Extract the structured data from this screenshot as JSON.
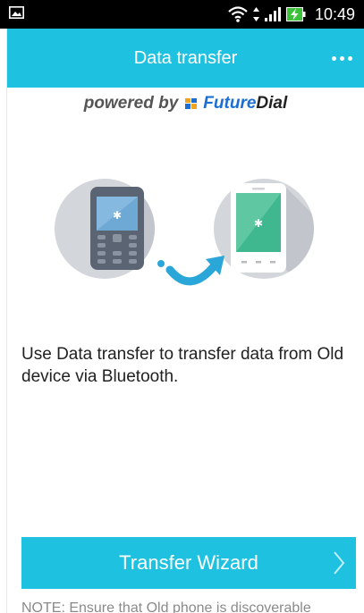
{
  "status_bar": {
    "time": "10:49",
    "icons": [
      "gallery-icon",
      "wifi-icon",
      "data-arrows-icon",
      "signal-icon",
      "battery-charging-icon"
    ]
  },
  "app_bar": {
    "title": "Data transfer",
    "overflow_icon": "more-dots-icon"
  },
  "branding": {
    "powered_by": "powered by",
    "brand_future": "Future",
    "brand_dial": "Dial"
  },
  "illustration": {
    "old_phone_icon": "feature-phone-bluetooth-icon",
    "new_phone_icon": "smartphone-bluetooth-icon",
    "arrow_icon": "transfer-arrow-icon"
  },
  "main": {
    "description": "Use Data transfer to transfer data from Old device via Bluetooth."
  },
  "wizard_button": {
    "label": "Transfer Wizard",
    "icon": "chevron-right-icon"
  },
  "note": {
    "text": "NOTE: Ensure that Old phone is discoverable"
  },
  "colors": {
    "accent": "#1ec1e0",
    "circle_bg": "#d3d6db",
    "old_phone_body": "#5a6472",
    "old_phone_screen": "#6ea8d4",
    "new_phone_screen": "#3fb890",
    "arrow": "#2aa7d8"
  }
}
